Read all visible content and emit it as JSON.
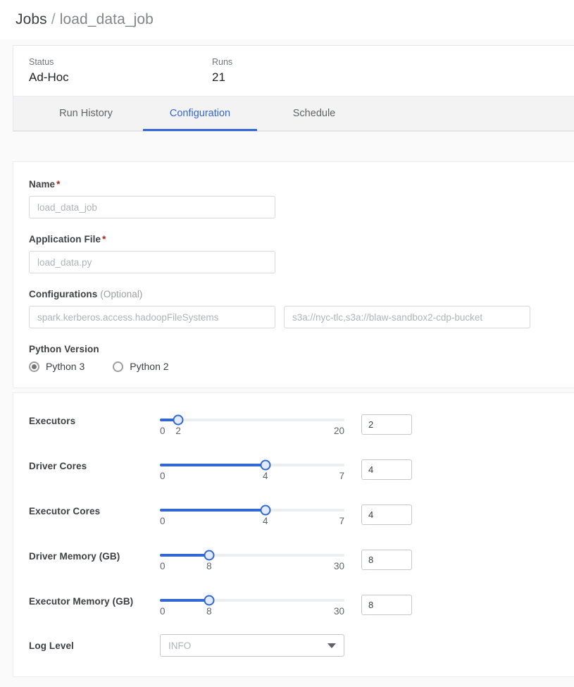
{
  "breadcrumb": {
    "root": "Jobs",
    "separator": "/",
    "leaf": "load_data_job"
  },
  "summary": [
    {
      "label": "Status",
      "value": "Ad-Hoc"
    },
    {
      "label": "Runs",
      "value": "21"
    }
  ],
  "tabs": [
    {
      "label": "Run History",
      "active": false
    },
    {
      "label": "Configuration",
      "active": true
    },
    {
      "label": "Schedule",
      "active": false
    }
  ],
  "form": {
    "name": {
      "label": "Name",
      "required_marker": "*",
      "placeholder": "load_data_job",
      "value": ""
    },
    "application_file": {
      "label": "Application File",
      "required_marker": "*",
      "placeholder": "load_data.py",
      "value": ""
    },
    "configurations": {
      "label": "Configurations",
      "optional_text": "(Optional)",
      "key_placeholder": "spark.kerberos.access.hadoopFileSystems",
      "key_value": "",
      "value_placeholder": "s3a://nyc-tlc,s3a://blaw-sandbox2-cdp-bucket",
      "value_value": ""
    },
    "python_version": {
      "label": "Python Version",
      "options": [
        {
          "label": "Python 3",
          "selected": true
        },
        {
          "label": "Python 2",
          "selected": false
        }
      ]
    }
  },
  "sliders": [
    {
      "label": "Executors",
      "min": 0,
      "max": 20,
      "value": 2,
      "input_value": "2"
    },
    {
      "label": "Driver Cores",
      "min": 0,
      "max": 7,
      "value": 4,
      "input_value": "4"
    },
    {
      "label": "Executor Cores",
      "min": 0,
      "max": 7,
      "value": 4,
      "input_value": "4"
    },
    {
      "label": "Driver Memory (GB)",
      "min": 0,
      "max": 30,
      "value": 8,
      "input_value": "8"
    },
    {
      "label": "Executor Memory (GB)",
      "min": 0,
      "max": 30,
      "value": 8,
      "input_value": "8"
    }
  ],
  "log_level": {
    "label": "Log Level",
    "placeholder": "INFO",
    "value": "",
    "icon": "chevron-down-icon"
  },
  "colors": {
    "accent": "#3367d6",
    "required": "#a52714",
    "page_bg": "#fafafa",
    "tabbar_bg": "#f3f3f4"
  }
}
